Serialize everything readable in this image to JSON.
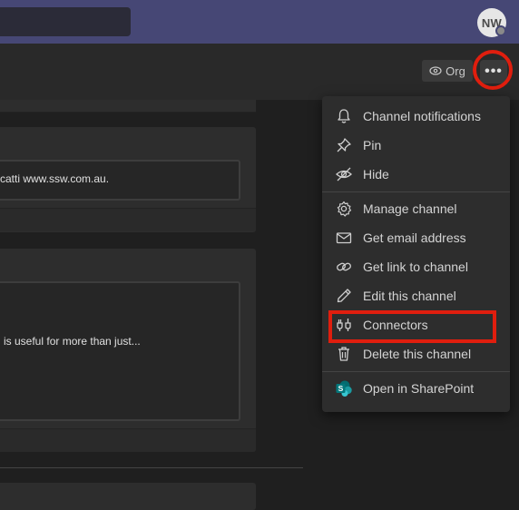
{
  "topbar": {
    "avatar_initials": "NW"
  },
  "header": {
    "org_label": "Org",
    "more_label": "•••"
  },
  "posts": {
    "post1_text": "catti www.ssw.com.au.",
    "post2_text": "is useful for more than just..."
  },
  "menu": {
    "items": [
      {
        "label": "Channel notifications",
        "icon": "bell-icon"
      },
      {
        "label": "Pin",
        "icon": "pin-icon"
      },
      {
        "label": "Hide",
        "icon": "eye-off-icon"
      },
      {
        "label": "Manage channel",
        "icon": "gear-icon"
      },
      {
        "label": "Get email address",
        "icon": "mail-icon"
      },
      {
        "label": "Get link to channel",
        "icon": "link-icon"
      },
      {
        "label": "Edit this channel",
        "icon": "pencil-icon"
      },
      {
        "label": "Connectors",
        "icon": "connectors-icon"
      },
      {
        "label": "Delete this channel",
        "icon": "trash-icon"
      },
      {
        "label": "Open in SharePoint",
        "icon": "sharepoint-icon"
      }
    ]
  },
  "colors": {
    "topbar": "#464775",
    "highlight": "#e01e0e",
    "sharepoint_teal": "#038387"
  }
}
